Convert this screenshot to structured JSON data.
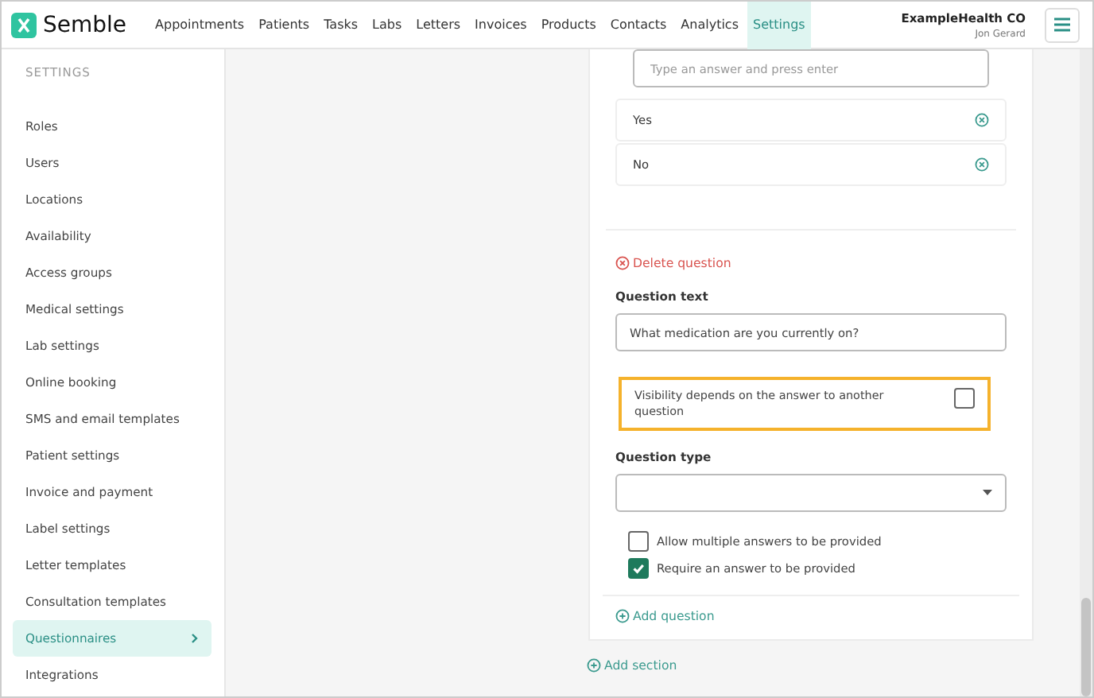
{
  "brand": "Semble",
  "nav": [
    {
      "label": "Appointments",
      "selected": false
    },
    {
      "label": "Patients",
      "selected": false
    },
    {
      "label": "Tasks",
      "selected": false
    },
    {
      "label": "Labs",
      "selected": false
    },
    {
      "label": "Letters",
      "selected": false
    },
    {
      "label": "Invoices",
      "selected": false
    },
    {
      "label": "Products",
      "selected": false
    },
    {
      "label": "Contacts",
      "selected": false
    },
    {
      "label": "Analytics",
      "selected": false
    },
    {
      "label": "Settings",
      "selected": true
    }
  ],
  "account": {
    "organisation": "ExampleHealth CO",
    "user": "Jon Gerard"
  },
  "sidebar": {
    "heading": "SETTINGS",
    "items": [
      {
        "label": "Roles",
        "selected": false
      },
      {
        "label": "Users",
        "selected": false
      },
      {
        "label": "Locations",
        "selected": false
      },
      {
        "label": "Availability",
        "selected": false
      },
      {
        "label": "Access groups",
        "selected": false
      },
      {
        "label": "Medical settings",
        "selected": false
      },
      {
        "label": "Lab settings",
        "selected": false
      },
      {
        "label": "Online booking",
        "selected": false
      },
      {
        "label": "SMS and email templates",
        "selected": false
      },
      {
        "label": "Patient settings",
        "selected": false
      },
      {
        "label": "Invoice and payment",
        "selected": false
      },
      {
        "label": "Label settings",
        "selected": false
      },
      {
        "label": "Letter templates",
        "selected": false
      },
      {
        "label": "Consultation templates",
        "selected": false
      },
      {
        "label": "Questionnaires",
        "selected": true
      },
      {
        "label": "Integrations",
        "selected": false
      }
    ]
  },
  "answer_input": {
    "placeholder": "Type an answer and press enter"
  },
  "answers": [
    "Yes",
    "No"
  ],
  "delete_question": "Delete question",
  "question_text": {
    "label": "Question text",
    "value": "What medication are you currently on?"
  },
  "visibility": {
    "label": "Visibility depends on the answer to another question",
    "checked": false,
    "highlighted": true
  },
  "question_type": {
    "label": "Question type"
  },
  "options": [
    {
      "label": "Allow multiple answers to be provided",
      "checked": false
    },
    {
      "label": "Require an answer to be provided",
      "checked": true
    }
  ],
  "add_question": "Add question",
  "add_section": "Add section"
}
